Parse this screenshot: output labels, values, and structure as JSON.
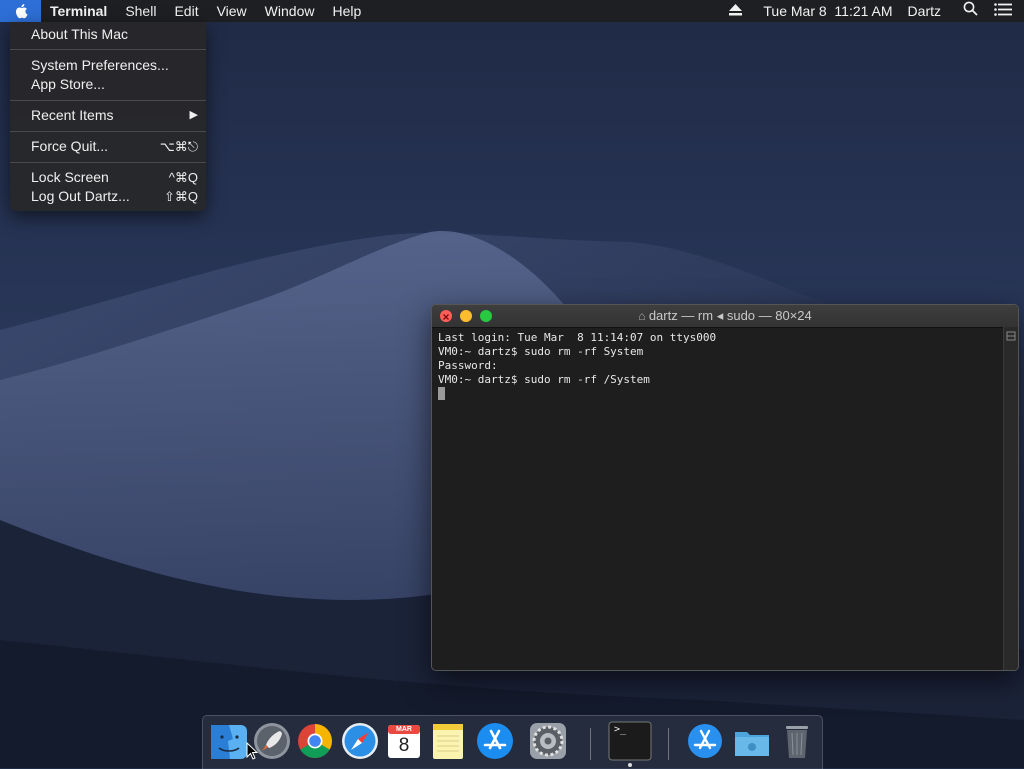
{
  "menubar": {
    "app_name": "Terminal",
    "menus": [
      "Shell",
      "Edit",
      "View",
      "Window",
      "Help"
    ],
    "clock": "Tue Mar 8  11:21 AM",
    "user": "Dartz"
  },
  "apple_menu": {
    "about": "About This Mac",
    "system_prefs": "System Preferences...",
    "app_store": "App Store...",
    "recent_items": "Recent Items",
    "force_quit": "Force Quit...",
    "force_quit_shortcut": "⌥⌘⎋",
    "lock_screen": "Lock Screen",
    "lock_screen_shortcut": "^⌘Q",
    "log_out": "Log Out Dartz...",
    "log_out_shortcut": "⇧⌘Q"
  },
  "terminal": {
    "title": "dartz — rm ◂ sudo — 80×24",
    "lines": [
      "Last login: Tue Mar  8 11:14:07 on ttys000",
      "VM0:~ dartz$ sudo rm -rf System",
      "Password:",
      "VM0:~ dartz$ sudo rm -rf /System"
    ]
  },
  "dock": {
    "calendar_month": "MAR",
    "calendar_day": "8",
    "terminal_prompt": ">_"
  },
  "colors": {
    "menu_highlight": "#2d6fd6",
    "close": "#ff5f57",
    "minimize": "#febc2e",
    "zoom": "#28c840"
  }
}
